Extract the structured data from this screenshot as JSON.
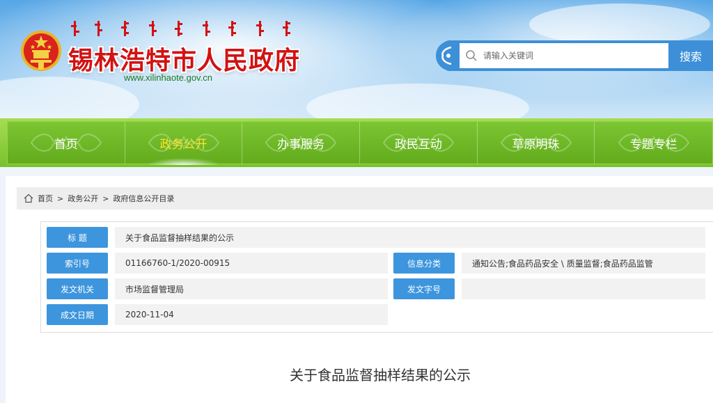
{
  "header": {
    "site_title": "锡林浩特市人民政府",
    "site_url": "www.xilinhaote.gov.cn",
    "search_placeholder": "请输入关键词",
    "search_button": "搜索"
  },
  "nav": {
    "items": [
      {
        "label": "首页",
        "active": false
      },
      {
        "label": "政务公开",
        "active": true
      },
      {
        "label": "办事服务",
        "active": false
      },
      {
        "label": "政民互动",
        "active": false
      },
      {
        "label": "草原明珠",
        "active": false
      },
      {
        "label": "专题专栏",
        "active": false
      }
    ]
  },
  "breadcrumb": {
    "items": [
      "首页",
      "政务公开",
      "政府信息公开目录"
    ],
    "separator": ">"
  },
  "info": {
    "title_label": "标 题",
    "title_value": "关于食品监督抽样结果的公示",
    "index_label": "索引号",
    "index_value": "01166760-1/2020-00915",
    "category_label": "信息分类",
    "category_value": "通知公告;食品药品安全 \\ 质量监督;食品药品监管",
    "issuer_label": "发文机关",
    "issuer_value": "市场监督管理局",
    "docno_label": "发文字号",
    "docno_value": "",
    "date_label": "成文日期",
    "date_value": "2020-11-04"
  },
  "article": {
    "title": "关于食品监督抽样结果的公示"
  },
  "colors": {
    "title_red": "#d21212",
    "nav_green": "#6cb726",
    "nav_active": "#ffe22a",
    "label_blue": "#3d95dd",
    "search_blue": "#3d8fd8"
  }
}
